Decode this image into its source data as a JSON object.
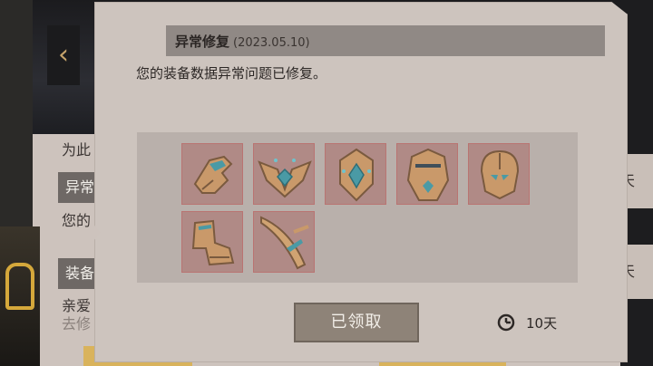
{
  "background": {
    "items": [
      {
        "text": "为此"
      },
      {
        "text": "异常"
      },
      {
        "text": "您的"
      },
      {
        "text": "装备"
      },
      {
        "text": "亲爱"
      },
      {
        "text": "去修"
      }
    ],
    "right_days_1": "天",
    "right_days_2": "天"
  },
  "mail": {
    "title": "异常修复",
    "date": "(2023.05.10)",
    "message": "您的装备数据异常问题已修复。",
    "rewards": [
      {
        "icon": "glove-icon"
      },
      {
        "icon": "winged-crest-icon"
      },
      {
        "icon": "gem-crest-icon"
      },
      {
        "icon": "chest-armor-icon"
      },
      {
        "icon": "helmet-icon"
      },
      {
        "icon": "boots-icon"
      },
      {
        "icon": "sword-icon"
      }
    ],
    "claim_button": "已领取",
    "expire_days": "10天"
  },
  "colors": {
    "modal_bg": "#cdc4be",
    "title_bar": "#908985",
    "reward_slot_border": "#b97472",
    "claim_button": "#8e8378"
  }
}
